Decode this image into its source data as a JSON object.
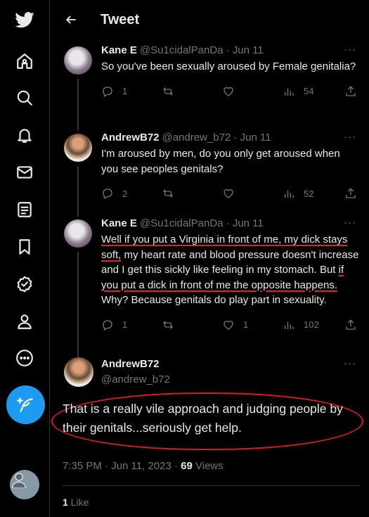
{
  "header": {
    "title": "Tweet"
  },
  "nav": {
    "icons": [
      "twitter-logo-icon",
      "home-icon",
      "search-icon",
      "notifications-icon",
      "messages-icon",
      "lists-icon",
      "bookmarks-icon",
      "verified-icon",
      "profile-icon",
      "more-icon"
    ]
  },
  "tweets": [
    {
      "name": "Kane E",
      "handle": "@Su1cidalPanDa · Jun 11",
      "text": "So you've been sexually aroused by Female genitalia?",
      "replies": "1",
      "retweets": "",
      "likes": "",
      "views": "54"
    },
    {
      "name": "AndrewB72",
      "handle": "@andrew_b72 · Jun 11",
      "text": "I'm aroused by men, do you only get aroused when you see peoples genitals?",
      "replies": "2",
      "retweets": "",
      "likes": "",
      "views": "52"
    },
    {
      "name": "Kane E",
      "handle": "@Su1cidalPanDa · Jun 11",
      "text_parts": [
        "Well if you put a Virginia in front of me, my dick stays soft,",
        " my heart rate and blood pressure doesn't increase and I get this sickly like feeling in my stomach. But ",
        "if you put a dick in front of me the opposite happens.",
        " Why? Because genitals do play part in sexuality."
      ],
      "replies": "1",
      "retweets": "",
      "likes": "1",
      "views": "102"
    }
  ],
  "focus": {
    "name": "AndrewB72",
    "handle": "@andrew_b72",
    "text": "That is a really vile approach and judging people by their genitals...seriously get help.",
    "time": "7:35 PM · Jun 11, 2023 · ",
    "views_count": "69",
    "views_label": " Views",
    "likes_count": "1",
    "likes_label": " Like"
  },
  "colors": {
    "accent": "#1d9bf0",
    "annotation": "#d81d24"
  }
}
